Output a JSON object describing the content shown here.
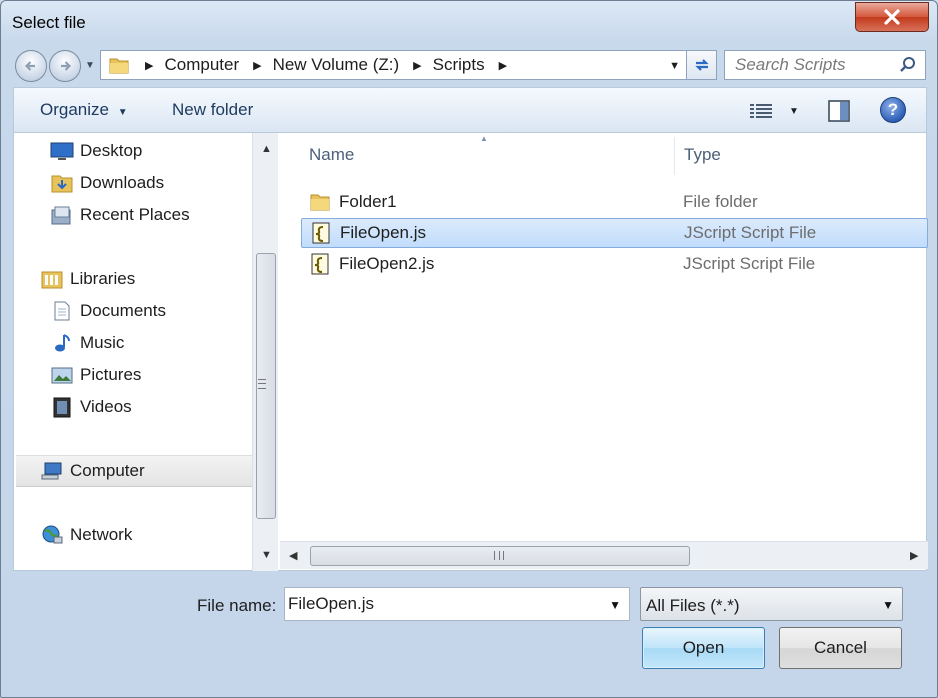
{
  "window": {
    "title": "Select file"
  },
  "address": {
    "crumbs": [
      {
        "label": "Computer"
      },
      {
        "label": "New Volume (Z:)"
      },
      {
        "label": "Scripts"
      }
    ]
  },
  "search": {
    "placeholder": "Search Scripts"
  },
  "toolbar": {
    "organize_label": "Organize",
    "new_folder_label": "New folder",
    "help_label": "?"
  },
  "nav": {
    "favorites": [
      {
        "label": "Desktop",
        "icon": "desktop-icon"
      },
      {
        "label": "Downloads",
        "icon": "downloads-folder-icon"
      },
      {
        "label": "Recent Places",
        "icon": "recent-places-icon"
      }
    ],
    "libraries": {
      "label": "Libraries",
      "items": [
        {
          "label": "Documents",
          "icon": "documents-icon"
        },
        {
          "label": "Music",
          "icon": "music-icon"
        },
        {
          "label": "Pictures",
          "icon": "pictures-icon"
        },
        {
          "label": "Videos",
          "icon": "videos-icon"
        }
      ]
    },
    "computer": {
      "label": "Computer"
    },
    "network": {
      "label": "Network"
    }
  },
  "files": {
    "columns": {
      "name": "Name",
      "type": "Type"
    },
    "rows": [
      {
        "name": "Folder1",
        "type": "File folder",
        "icon": "folder-icon",
        "selected": false
      },
      {
        "name": "FileOpen.js",
        "type": "JScript Script File",
        "icon": "jscript-file-icon",
        "selected": true
      },
      {
        "name": "FileOpen2.js",
        "type": "JScript Script File",
        "icon": "jscript-file-icon",
        "selected": false
      }
    ]
  },
  "footer": {
    "file_name_label": "File name:",
    "file_name_value": "FileOpen.js",
    "filter_value": "All Files (*.*)",
    "open_label": "Open",
    "cancel_label": "Cancel"
  },
  "colors": {
    "selection": "#c1dcfc",
    "open_button": "#a7d9f5",
    "close_button": "#c23a1c"
  }
}
